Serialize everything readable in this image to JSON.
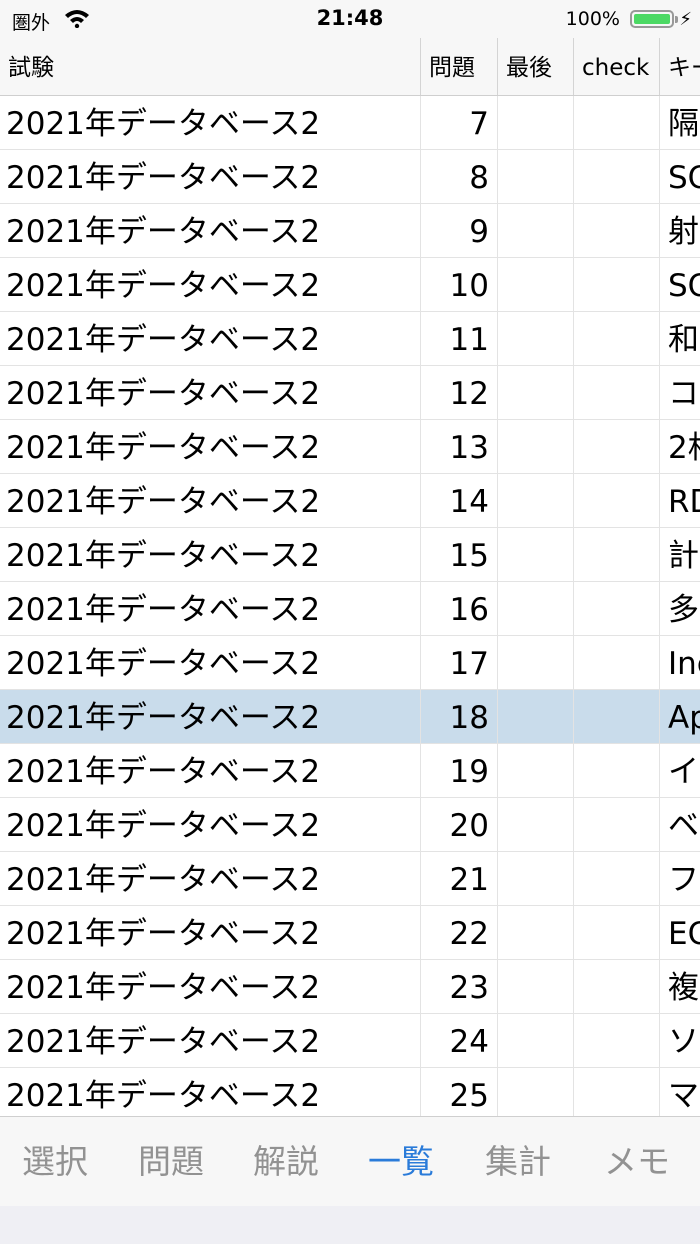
{
  "status_bar": {
    "carrier": "圏外",
    "time": "21:48",
    "battery_percent": "100%",
    "battery_level": 1.0
  },
  "columns": [
    "試験",
    "問題",
    "最後",
    "check",
    "キー"
  ],
  "rows": [
    {
      "exam": "2021年データベース2",
      "q": "7",
      "last": "",
      "check": "",
      "key": "隔"
    },
    {
      "exam": "2021年データベース2",
      "q": "8",
      "last": "",
      "check": "",
      "key": "SC"
    },
    {
      "exam": "2021年データベース2",
      "q": "9",
      "last": "",
      "check": "",
      "key": "射"
    },
    {
      "exam": "2021年データベース2",
      "q": "10",
      "last": "",
      "check": "",
      "key": "SC"
    },
    {
      "exam": "2021年データベース2",
      "q": "11",
      "last": "",
      "check": "",
      "key": "和"
    },
    {
      "exam": "2021年データベース2",
      "q": "12",
      "last": "",
      "check": "",
      "key": "コ"
    },
    {
      "exam": "2021年データベース2",
      "q": "13",
      "last": "",
      "check": "",
      "key": "2相"
    },
    {
      "exam": "2021年データベース2",
      "q": "14",
      "last": "",
      "check": "",
      "key": "RD"
    },
    {
      "exam": "2021年データベース2",
      "q": "15",
      "last": "",
      "check": "",
      "key": "計"
    },
    {
      "exam": "2021年データベース2",
      "q": "16",
      "last": "",
      "check": "",
      "key": "多"
    },
    {
      "exam": "2021年データベース2",
      "q": "17",
      "last": "",
      "check": "",
      "key": "Inc"
    },
    {
      "exam": "2021年データベース2",
      "q": "18",
      "last": "",
      "check": "",
      "key": "Ap",
      "selected": true
    },
    {
      "exam": "2021年データベース2",
      "q": "19",
      "last": "",
      "check": "",
      "key": "イ"
    },
    {
      "exam": "2021年データベース2",
      "q": "20",
      "last": "",
      "check": "",
      "key": "ベ"
    },
    {
      "exam": "2021年データベース2",
      "q": "21",
      "last": "",
      "check": "",
      "key": "フ"
    },
    {
      "exam": "2021年データベース2",
      "q": "22",
      "last": "",
      "check": "",
      "key": "EC"
    },
    {
      "exam": "2021年データベース2",
      "q": "23",
      "last": "",
      "check": "",
      "key": "複"
    },
    {
      "exam": "2021年データベース2",
      "q": "24",
      "last": "",
      "check": "",
      "key": "ソ"
    },
    {
      "exam": "2021年データベース2",
      "q": "25",
      "last": "",
      "check": "",
      "key": "マ"
    }
  ],
  "tabs": [
    {
      "label": "選択"
    },
    {
      "label": "問題"
    },
    {
      "label": "解説"
    },
    {
      "label": "一覧",
      "active": true
    },
    {
      "label": "集計"
    },
    {
      "label": "メモ"
    }
  ],
  "colors": {
    "accent": "#2a7bd9",
    "selected_row": "#c9dceb",
    "battery": "#4cd964"
  }
}
